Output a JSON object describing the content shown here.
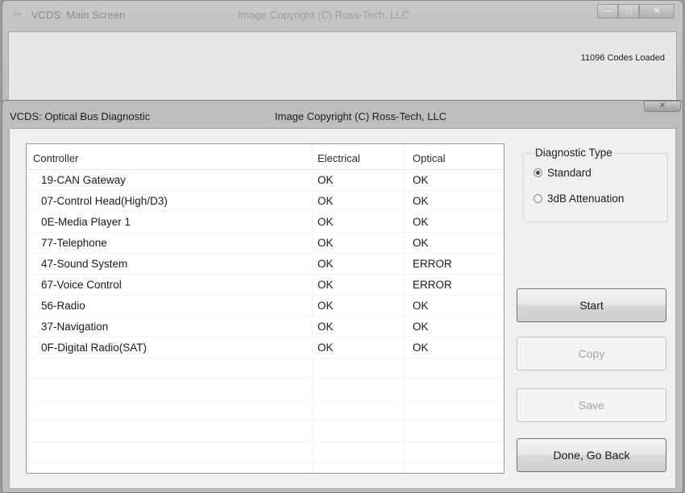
{
  "main_window": {
    "title": "VCDS:  Main Screen",
    "copyright": "Image Copyright (C) Ross-Tech, LLC",
    "codes_loaded": "11096 Codes Loaded"
  },
  "dialog": {
    "title": "VCDS:  Optical Bus Diagnostic",
    "copyright": "Image Copyright (C) Ross-Tech, LLC"
  },
  "table": {
    "headers": [
      "Controller",
      "Electrical",
      "Optical"
    ],
    "rows": [
      [
        "19-CAN Gateway",
        "OK",
        "OK"
      ],
      [
        "07-Control Head(High/D3)",
        "OK",
        "OK"
      ],
      [
        "0E-Media Player 1",
        "OK",
        "OK"
      ],
      [
        "77-Telephone",
        "OK",
        "OK"
      ],
      [
        "47-Sound System",
        "OK",
        "ERROR"
      ],
      [
        "67-Voice Control",
        "OK",
        "ERROR"
      ],
      [
        "56-Radio",
        "OK",
        "OK"
      ],
      [
        "37-Navigation",
        "OK",
        "OK"
      ],
      [
        "0F-Digital Radio(SAT)",
        "OK",
        "OK"
      ]
    ]
  },
  "diagnostic_type": {
    "legend": "Diagnostic Type",
    "options": [
      {
        "label": "Standard",
        "selected": true
      },
      {
        "label": "3dB Attenuation",
        "selected": false
      }
    ]
  },
  "buttons": {
    "start": "Start",
    "copy": "Copy",
    "save": "Save",
    "done": "Done, Go Back"
  }
}
